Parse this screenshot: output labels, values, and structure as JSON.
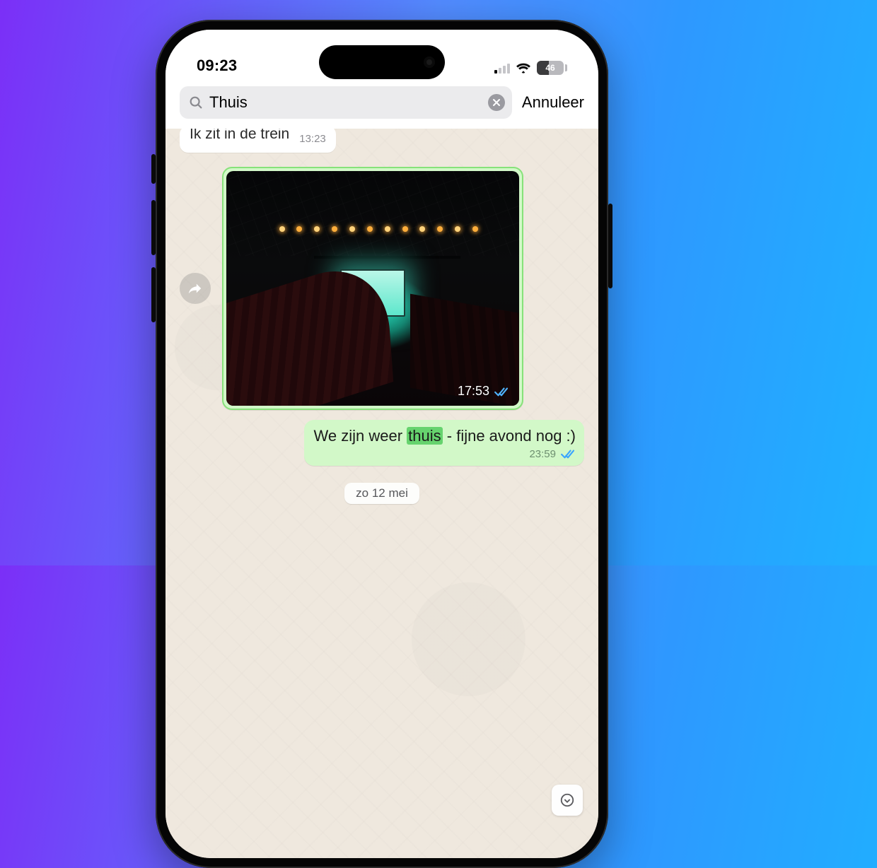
{
  "status": {
    "time": "09:23",
    "battery_pct": "46"
  },
  "search": {
    "value": "Thuis",
    "cancel_label": "Annuleer"
  },
  "chat": {
    "incoming_stub_text": "Ik zit in de trein",
    "incoming_stub_time": "13:23",
    "image_msg_time": "17:53",
    "text_msg_before": "We zijn weer ",
    "text_msg_highlight": "thuis",
    "text_msg_after": " - fijne avond nog :)",
    "text_msg_time": "23:59",
    "date_chip": "zo 12 mei"
  }
}
